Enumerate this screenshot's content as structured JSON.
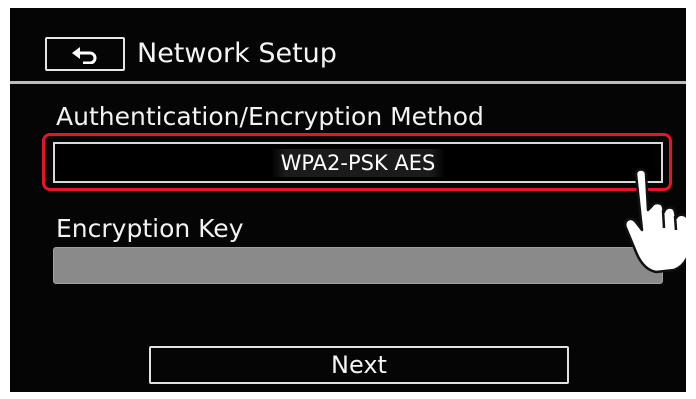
{
  "header": {
    "title": "Network Setup",
    "back_icon": "return-arrow-icon"
  },
  "auth": {
    "label": "Authentication/Encryption Method",
    "value": "WPA2-PSK AES",
    "highlight_color": "#e4152b"
  },
  "key": {
    "label": "Encryption Key",
    "value": ""
  },
  "footer": {
    "next_label": "Next"
  },
  "pointer": {
    "icon": "pointing-hand-icon"
  },
  "colors": {
    "background": "#050505",
    "text": "#ffffff",
    "field_fill_disabled": "#8a8a8a"
  }
}
